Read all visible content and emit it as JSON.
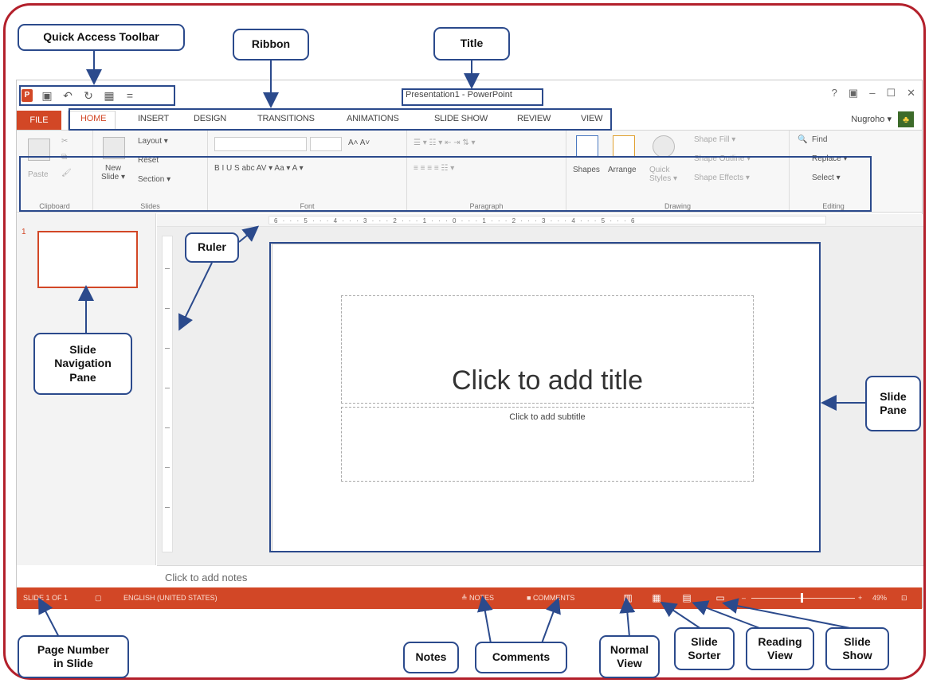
{
  "titlebar": {
    "document_title": "Presentation1 - PowerPoint",
    "window_controls": [
      "?",
      "▣",
      "–",
      "☐",
      "✕"
    ]
  },
  "qat": {
    "icons": [
      "powerpoint-logo",
      "save-icon",
      "undo-icon",
      "redo-icon",
      "start-from-beginning-icon",
      "customize-icon"
    ]
  },
  "tabs": {
    "file": "FILE",
    "items": [
      "HOME",
      "INSERT",
      "DESIGN",
      "TRANSITIONS",
      "ANIMATIONS",
      "SLIDE SHOW",
      "REVIEW",
      "VIEW"
    ],
    "active": "HOME",
    "user": "Nugroho ▾"
  },
  "ribbon": {
    "clipboard": {
      "paste": "Paste",
      "label": "Clipboard"
    },
    "slides": {
      "new_slide": "New\nSlide ▾",
      "layout": "Layout ▾",
      "reset": "Reset",
      "section": "Section ▾",
      "label": "Slides"
    },
    "font": {
      "label": "Font",
      "format_row": "B  I  U  S  abc  AV ▾  Aa ▾  A ▾"
    },
    "paragraph": {
      "label": "Paragraph"
    },
    "drawing": {
      "shapes": "Shapes",
      "arrange": "Arrange",
      "quick_styles": "Quick\nStyles ▾",
      "shape_fill": "Shape Fill ▾",
      "shape_outline": "Shape Outline ▾",
      "shape_effects": "Shape Effects ▾",
      "label": "Drawing"
    },
    "editing": {
      "find": "Find",
      "replace": "Replace ▾",
      "select": "Select ▾",
      "label": "Editing"
    }
  },
  "thumbnails": {
    "number": "1"
  },
  "ruler": {
    "marks": "6 · · · 5 · · · 4 · · · 3 · · · 2 · · · 1 · · · 0 · · · 1 · · · 2 · · · 3 · · · 4 · · · 5 · · · 6"
  },
  "slide": {
    "title_placeholder": "Click to add title",
    "subtitle_placeholder": "Click to add subtitle"
  },
  "notes": {
    "placeholder": "Click to add notes"
  },
  "statusbar": {
    "slide_info": "SLIDE 1 OF 1",
    "language": "ENGLISH (UNITED STATES)",
    "notes": "NOTES",
    "comments": "COMMENTS",
    "zoom": "49%"
  },
  "callouts": {
    "quick_access_toolbar": "Quick Access Toolbar",
    "ribbon": "Ribbon",
    "title": "Title",
    "ruler": "Ruler",
    "slide_navigation_pane": "Slide\nNavigation\nPane",
    "slide_pane": "Slide\nPane",
    "page_number": "Page Number\nin Slide",
    "notes": "Notes",
    "comments": "Comments",
    "normal_view": "Normal\nView",
    "slide_sorter": "Slide\nSorter",
    "reading_view": "Reading\nView",
    "slide_show": "Slide\nShow"
  },
  "colors": {
    "accent": "#d24726",
    "frame": "#b3202b",
    "callout_border": "#2b4a8c"
  }
}
